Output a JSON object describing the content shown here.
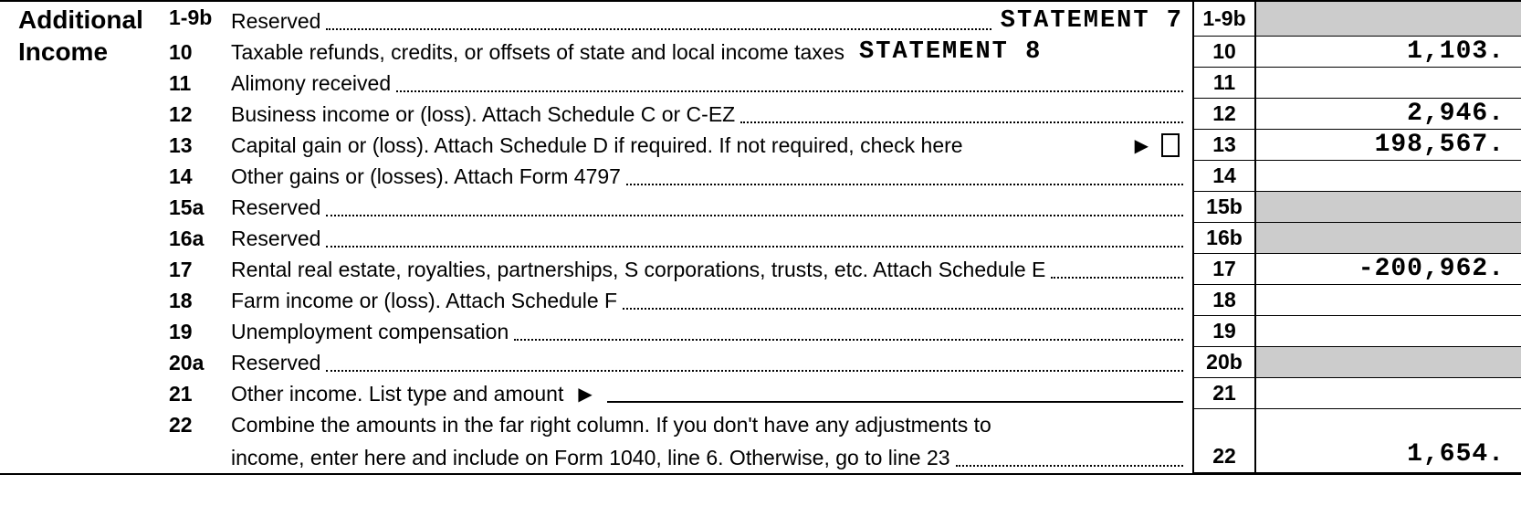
{
  "section_title": "Additional Income",
  "lines": {
    "l1_9b": {
      "num_left": "1-9b",
      "desc": "Reserved",
      "stmt": "STATEMENT  7",
      "num_right": "1-9b",
      "amount": "",
      "shaded": true
    },
    "l10": {
      "num_left": "10",
      "desc": "Taxable refunds, credits, or offsets of state and local income taxes",
      "stmt": "STATEMENT  8",
      "num_right": "10",
      "amount": "1,103."
    },
    "l11": {
      "num_left": "11",
      "desc": "Alimony received",
      "num_right": "11",
      "amount": ""
    },
    "l12": {
      "num_left": "12",
      "desc": "Business income or (loss). Attach Schedule C or C-EZ",
      "num_right": "12",
      "amount": "2,946."
    },
    "l13": {
      "num_left": "13",
      "desc": "Capital gain or (loss). Attach Schedule D if required. If not required, check here",
      "num_right": "13",
      "amount": "198,567."
    },
    "l14": {
      "num_left": "14",
      "desc": "Other gains or (losses). Attach Form 4797",
      "num_right": "14",
      "amount": ""
    },
    "l15": {
      "num_left": "15a",
      "desc": "Reserved",
      "num_right": "15b",
      "amount": "",
      "shaded": true
    },
    "l16": {
      "num_left": "16a",
      "desc": "Reserved",
      "num_right": "16b",
      "amount": "",
      "shaded": true
    },
    "l17": {
      "num_left": "17",
      "desc": "Rental real estate, royalties, partnerships, S corporations, trusts, etc. Attach Schedule E",
      "num_right": "17",
      "amount": "-200,962."
    },
    "l18": {
      "num_left": "18",
      "desc": "Farm income or (loss). Attach Schedule F",
      "num_right": "18",
      "amount": ""
    },
    "l19": {
      "num_left": "19",
      "desc": "Unemployment compensation",
      "num_right": "19",
      "amount": ""
    },
    "l20": {
      "num_left": "20a",
      "desc": "Reserved",
      "num_right": "20b",
      "amount": "",
      "shaded": true
    },
    "l21": {
      "num_left": "21",
      "desc": "Other income. List type and amount",
      "num_right": "21",
      "amount": ""
    },
    "l22": {
      "num_left": "22",
      "desc1": "Combine the amounts in the far right column. If you don't have any adjustments to",
      "desc2": "income, enter here and include on Form 1040, line 6. Otherwise, go to line 23",
      "num_right": "22",
      "amount": "1,654."
    }
  }
}
